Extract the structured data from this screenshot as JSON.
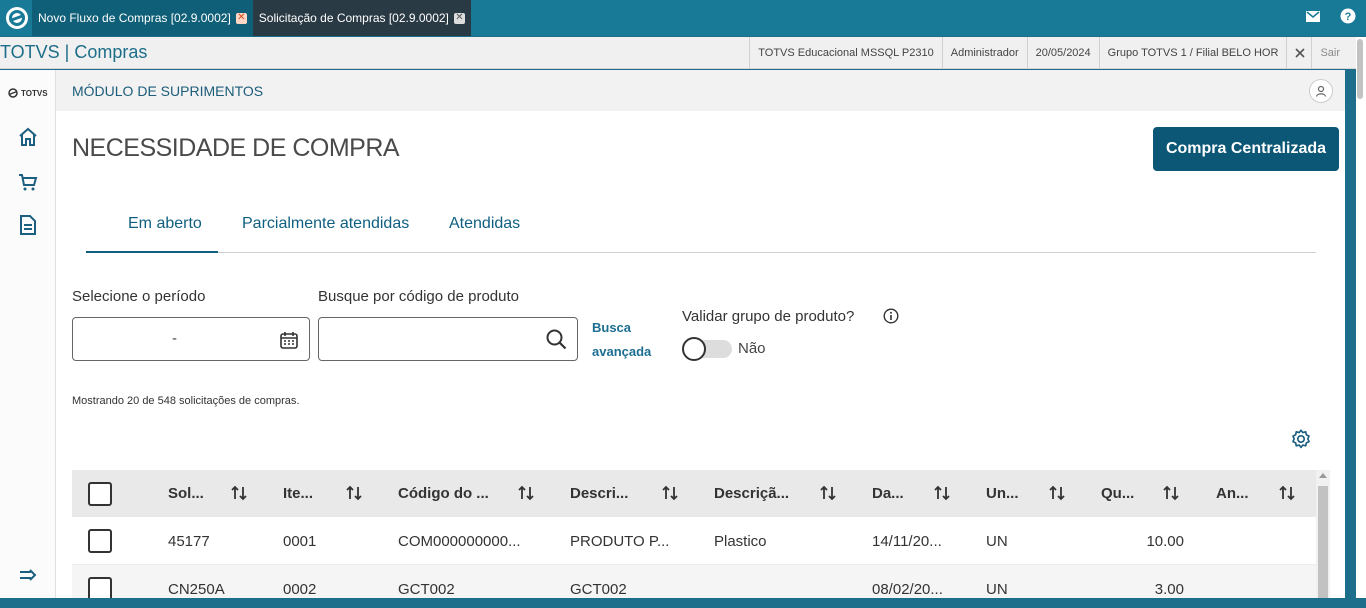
{
  "tabs": [
    {
      "label": "Novo Fluxo de Compras [02.9.0002]",
      "active": true
    },
    {
      "label": "Solicitação de Compras [02.9.0002]",
      "active": false
    }
  ],
  "header": {
    "brand": "TOTVS | Compras",
    "database": "TOTVS Educacional MSSQL P2310",
    "user": "Administrador",
    "date": "20/05/2024",
    "group": "Grupo TOTVS 1 / Filial BELO HOR",
    "exit_label": "Sair"
  },
  "sidebar": {
    "logo_text": "TOTVS",
    "items": [
      "home-icon",
      "cart-icon",
      "document-icon",
      "expand-icon"
    ]
  },
  "module": {
    "title": "MÓDULO DE SUPRIMENTOS"
  },
  "page": {
    "title": "NECESSIDADE DE COMPRA",
    "primary_button": "Compra Centralizada"
  },
  "status_tabs": [
    {
      "label": "Em aberto",
      "selected": true
    },
    {
      "label": "Parcialmente atendidas",
      "selected": false
    },
    {
      "label": "Atendidas",
      "selected": false
    }
  ],
  "filters": {
    "period_label": "Selecione o período",
    "period_value": "-",
    "product_label": "Busque por código de produto",
    "product_value": "",
    "advanced_search_line1": "Busca",
    "advanced_search_line2": "avançada",
    "validate_label": "Validar grupo de produto?",
    "validate_value": "Não",
    "validate_on": false
  },
  "results_text": "Mostrando 20 de 548 solicitações de compras.",
  "table": {
    "columns": [
      "Sol...",
      "Ite...",
      "Código do ...",
      "Descri...",
      "Descriçã...",
      "Da...",
      "Un...",
      "Qu...",
      "An..."
    ],
    "rows": [
      [
        "45177",
        "0001",
        "COM000000000...",
        "PRODUTO P...",
        "Plastico",
        "14/11/20...",
        "UN",
        "10.00",
        ""
      ],
      [
        "CN250A",
        "0002",
        "GCT002",
        "GCT002",
        "",
        "08/02/20...",
        "UN",
        "3.00",
        ""
      ]
    ]
  },
  "colors": {
    "accent": "#0c5676",
    "top_bar": "#197a97",
    "link": "#1c6e92"
  }
}
